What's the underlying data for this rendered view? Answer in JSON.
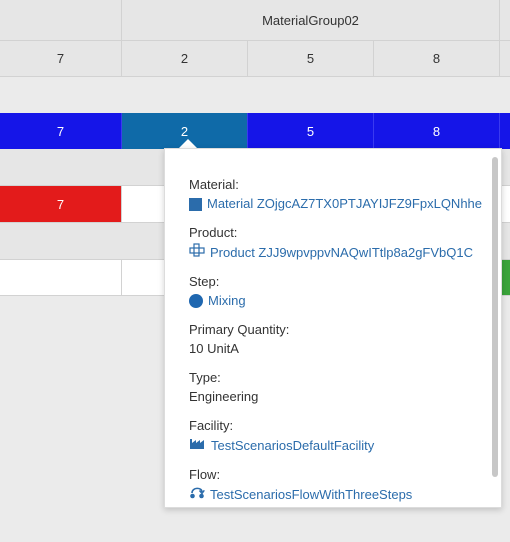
{
  "header": {
    "group_title": "MaterialGroup02"
  },
  "rows": {
    "plan_values": [
      "7",
      "2",
      "5",
      "8"
    ],
    "active_values": [
      "7",
      "2",
      "5",
      "8"
    ],
    "alert_values": [
      "7"
    ]
  },
  "colors": {
    "active_row": "#1515e8",
    "selected_cell": "#0f6aa8",
    "alert_cell": "#e31b1b",
    "success_cell": "#3aa43a",
    "link": "#2b6cab"
  },
  "tooltip": {
    "material": {
      "label": "Material:",
      "value": "Material ZOjgcAZ7TX0PTJAYIJFZ9FpxLQNhhe",
      "icon": "material-square-icon"
    },
    "product": {
      "label": "Product:",
      "value": "Product ZJJ9wpvppvNAQwITtlp8a2gFVbQ1C",
      "icon": "product-icon"
    },
    "step": {
      "label": "Step:",
      "value": "Mixing",
      "icon": "step-circle-icon"
    },
    "primary_quantity": {
      "label": "Primary Quantity:",
      "value": "10 UnitA"
    },
    "type": {
      "label": "Type:",
      "value": "Engineering"
    },
    "facility": {
      "label": "Facility:",
      "value": "TestScenariosDefaultFacility",
      "icon": "factory-icon"
    },
    "flow": {
      "label": "Flow:",
      "value": "TestScenariosFlowWithThreeSteps",
      "icon": "flow-icon"
    }
  }
}
